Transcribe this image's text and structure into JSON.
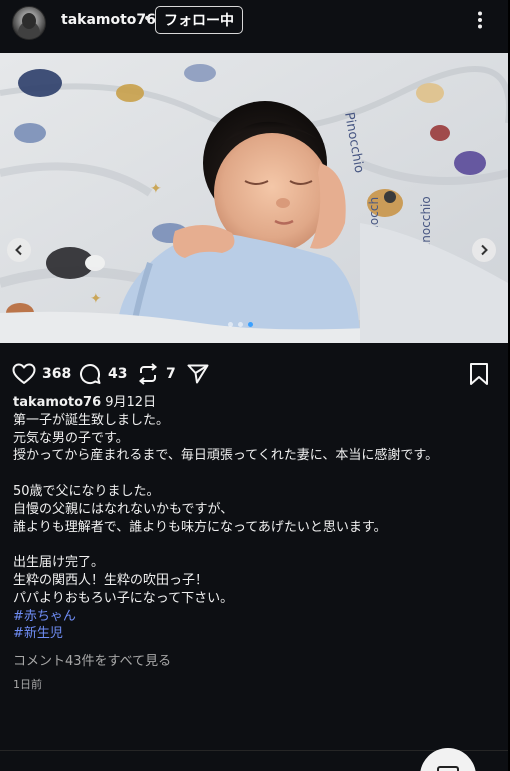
{
  "header": {
    "username": "takamoto76",
    "separator": "•",
    "follow_label": "フォロー中",
    "more_icon": "more-vertical-icon"
  },
  "carousel": {
    "prev_icon": "chevron-left-icon",
    "next_icon": "chevron-right-icon",
    "dot_count": 3,
    "active_dot": 2
  },
  "actions": {
    "likes": "368",
    "comments": "43",
    "reposts": "7",
    "icons": [
      "heart-icon",
      "comment-icon",
      "repost-icon",
      "send-icon",
      "bookmark-icon"
    ]
  },
  "caption": {
    "author": "takamoto76",
    "date": "9月12日",
    "lines": [
      "第一子が誕生致しました。",
      "元気な男の子です。",
      "授かってから産まれるまで、毎日頑張ってくれた妻に、本当に感謝です。",
      "",
      "50歳で父になりました。",
      "自慢の父親にはなれないかもですが、",
      "誰よりも理解者で、誰よりも味方になってあげたいと思います。",
      "",
      "出生届け完了。",
      "生粋の関西人！生粋の吹田っ子！",
      "パパよりおもろい子になって下さい。"
    ],
    "hashtags": [
      "#赤ちゃん",
      "#新生児"
    ]
  },
  "view_comments": "コメント43件をすべて見る",
  "time_ago": "1日前",
  "colors": {
    "background": "#0d0f13",
    "hashtag": "#6f8df5",
    "muted": "#a8a8a8"
  }
}
